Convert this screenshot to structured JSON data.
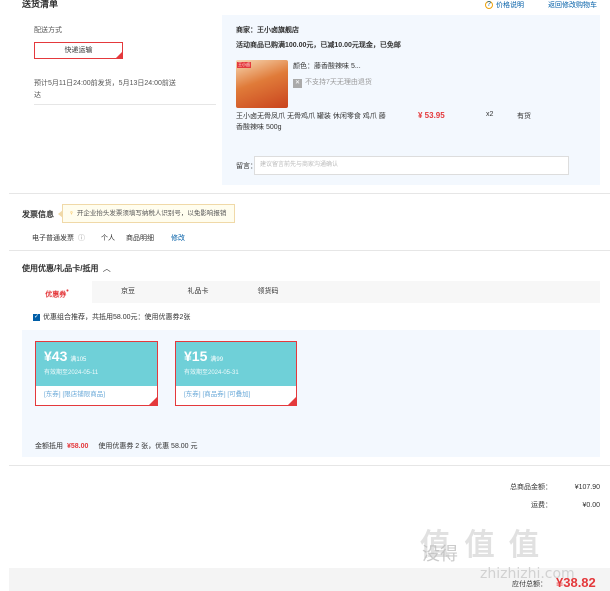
{
  "header": {
    "title": "送货清单",
    "price_help": "价格说明",
    "back_to_cart": "返回修改购物车"
  },
  "delivery": {
    "label": "配送方式",
    "method_button": "快递运输",
    "estimate": "预计5月11日24:00前发货，5月13日24:00前送达"
  },
  "store": {
    "name": "商家：王小卤旗舰店",
    "promo": "活动商品已购满100.00元，已减10.00元现金，已免邮",
    "product": {
      "img_tag": "王小卤",
      "color": "颜色：藤香酸辣味 5...",
      "return_policy": "不支持7天无理由退货",
      "title": "王小卤无骨凤爪 无骨鸡爪 罐装 休闲零食 鸡爪 藤香酸辣味 500g",
      "price": "¥ 53.95",
      "qty": "x2",
      "stock": "有货"
    },
    "remark_label": "留言：",
    "remark_placeholder": "建议留言前先与商家沟通确认"
  },
  "invoice": {
    "label": "发票信息",
    "tip": "开企业抬头发票须填写纳税人识别号，以免影响报销",
    "type": "电子普通发票",
    "title_type": "个人",
    "content": "商品明细",
    "edit": "修改"
  },
  "discount": {
    "label": "使用优惠/礼品卡/抵用",
    "tabs": [
      "优惠券",
      "京豆",
      "礼品卡",
      "领货码"
    ],
    "recommend": "优惠组合推荐，共抵用58.00元：使用优惠券2张",
    "coupons": [
      {
        "amount": "¥43",
        "cond": "满105",
        "date": "有效期至2024-05-11",
        "tags": [
          "[东券]",
          "[限店铺限商品]"
        ]
      },
      {
        "amount": "¥15",
        "cond": "满99",
        "date": "有效期至2024-05-31",
        "tags": [
          "[东券]",
          "[商品券]",
          "[可叠加]"
        ]
      }
    ],
    "summary_label": "金额抵用",
    "summary_amount": "¥58.00",
    "summary_detail": "使用优惠券 2 张，优惠 58.00 元"
  },
  "totals": {
    "goods_label": "总商品金额：",
    "goods_value": "¥107.90",
    "shipping_label": "运费：",
    "shipping_value": "¥0.00",
    "pay_label": "应付总额：",
    "pay_value": "¥38.82"
  },
  "watermark": {
    "text": "值 值 值",
    "sub": "没得",
    "url": "zhizhizhi.com"
  }
}
